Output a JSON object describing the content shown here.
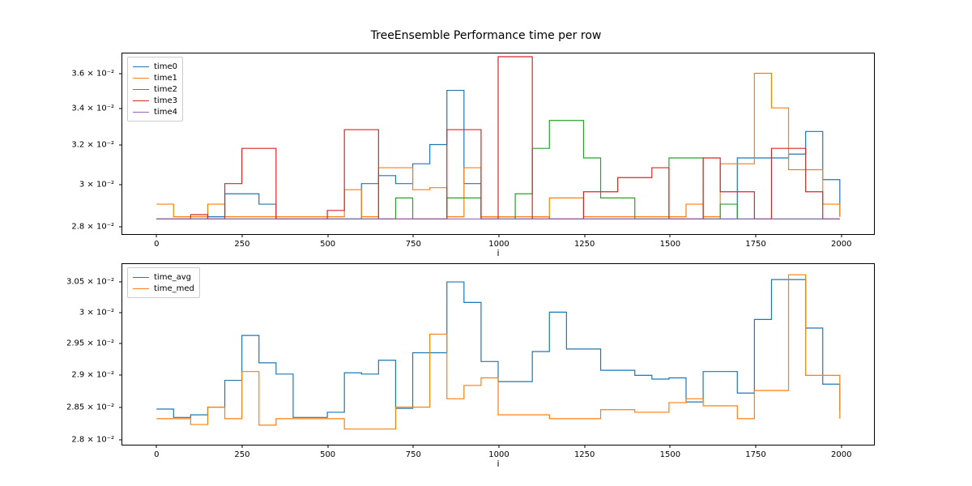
{
  "title": "TreeEnsemble Performance time per row",
  "axes_top": {
    "xlabel": "i",
    "xlim": [
      -100,
      2100
    ],
    "ylim_log": [
      0.0276,
      0.0372
    ],
    "xticks": [
      0,
      250,
      500,
      750,
      1000,
      1250,
      1500,
      1750,
      2000
    ],
    "yticks": [
      {
        "v": 0.028,
        "label": "2.8 × 10⁻²"
      },
      {
        "v": 0.03,
        "label": "3 × 10⁻²"
      },
      {
        "v": 0.032,
        "label": "3.2 × 10⁻²"
      },
      {
        "v": 0.034,
        "label": "3.4 × 10⁻²"
      },
      {
        "v": 0.036,
        "label": "3.6 × 10⁻²"
      }
    ],
    "legend": [
      {
        "label": "time0",
        "color": "#1f77b4"
      },
      {
        "label": "time1",
        "color": "#ff7f0e"
      },
      {
        "label": "time2",
        "color": "#2ca02c"
      },
      {
        "label": "time3",
        "color": "#d62728"
      },
      {
        "label": "time4",
        "color": "#9467bd"
      }
    ]
  },
  "axes_bottom": {
    "xlabel": "i",
    "xlim": [
      -100,
      2100
    ],
    "ylim_log": [
      0.0279,
      0.0308
    ],
    "xticks": [
      0,
      250,
      500,
      750,
      1000,
      1250,
      1500,
      1750,
      2000
    ],
    "yticks": [
      {
        "v": 0.028,
        "label": "2.8 × 10⁻²"
      },
      {
        "v": 0.0285,
        "label": "2.85 × 10⁻²"
      },
      {
        "v": 0.029,
        "label": "2.9 × 10⁻²"
      },
      {
        "v": 0.0295,
        "label": "2.95 × 10⁻²"
      },
      {
        "v": 0.03,
        "label": "3 × 10⁻²"
      },
      {
        "v": 0.0305,
        "label": "3.05 × 10⁻²"
      }
    ],
    "legend": [
      {
        "label": "time_avg",
        "color": "#1f77b4"
      },
      {
        "label": "time_med",
        "color": "#ff7f0e"
      }
    ]
  },
  "chart_data": [
    {
      "type": "line",
      "drawstyle": "steps-post",
      "title": "TreeEnsemble Performance time per row",
      "xlabel": "i",
      "ylabel": "",
      "yscale": "log",
      "xlim": [
        -100,
        2100
      ],
      "ylim": [
        0.0276,
        0.0372
      ],
      "x": [
        0,
        50,
        100,
        150,
        200,
        250,
        300,
        350,
        400,
        450,
        500,
        550,
        600,
        650,
        700,
        750,
        800,
        850,
        900,
        950,
        1000,
        1050,
        1100,
        1150,
        1200,
        1250,
        1300,
        1350,
        1400,
        1450,
        1500,
        1550,
        1600,
        1650,
        1700,
        1750,
        1800,
        1850,
        1900,
        1950,
        2000
      ],
      "series": [
        {
          "name": "time0",
          "color": "#1f77b4",
          "values": [
            0.0283,
            0.0283,
            0.0283,
            0.0284,
            0.0295,
            0.0295,
            0.029,
            0.0283,
            0.0283,
            0.0283,
            0.0283,
            0.0283,
            0.03,
            0.0304,
            0.03,
            0.031,
            0.032,
            0.035,
            0.03,
            0.0284,
            0.0284,
            0.0283,
            0.0284,
            0.0283,
            0.0283,
            0.0283,
            0.0283,
            0.0283,
            0.0283,
            0.0283,
            0.0283,
            0.0283,
            0.0283,
            0.0283,
            0.0313,
            0.0313,
            0.0313,
            0.0315,
            0.0327,
            0.0302,
            0.0284
          ]
        },
        {
          "name": "time1",
          "color": "#ff7f0e",
          "values": [
            0.029,
            0.0284,
            0.0284,
            0.029,
            0.0284,
            0.0284,
            0.0284,
            0.0284,
            0.0284,
            0.0284,
            0.0284,
            0.0297,
            0.0284,
            0.0308,
            0.0308,
            0.0297,
            0.0298,
            0.0284,
            0.0308,
            0.0284,
            0.0284,
            0.0284,
            0.0284,
            0.0293,
            0.0293,
            0.0284,
            0.0284,
            0.0284,
            0.0284,
            0.0284,
            0.0284,
            0.029,
            0.0284,
            0.031,
            0.031,
            0.036,
            0.034,
            0.0307,
            0.0307,
            0.029,
            0.0284
          ]
        },
        {
          "name": "time2",
          "color": "#2ca02c",
          "values": [
            0.0283,
            0.0283,
            0.0283,
            0.0283,
            0.0283,
            0.0283,
            0.0283,
            0.0283,
            0.0283,
            0.0283,
            0.0283,
            0.0283,
            0.0283,
            0.0283,
            0.0293,
            0.0283,
            0.0283,
            0.0293,
            0.0293,
            0.0283,
            0.0283,
            0.0295,
            0.0318,
            0.0333,
            0.0333,
            0.0313,
            0.0293,
            0.0293,
            0.0283,
            0.0283,
            0.0313,
            0.0313,
            0.0283,
            0.029,
            0.0283,
            0.0283,
            0.0283,
            0.0283,
            0.0283,
            0.0283,
            0.0283
          ]
        },
        {
          "name": "time3",
          "color": "#d62728",
          "values": [
            0.0283,
            0.0283,
            0.0285,
            0.0283,
            0.03,
            0.0318,
            0.0318,
            0.0283,
            0.0283,
            0.0283,
            0.0287,
            0.0328,
            0.0328,
            0.0283,
            0.0283,
            0.0283,
            0.0283,
            0.0328,
            0.0328,
            0.0283,
            0.037,
            0.037,
            0.0283,
            0.0283,
            0.0283,
            0.0296,
            0.0296,
            0.0303,
            0.0303,
            0.0308,
            0.0283,
            0.0283,
            0.0313,
            0.0296,
            0.0296,
            0.0283,
            0.0318,
            0.0318,
            0.0296,
            0.0283,
            0.0283
          ]
        },
        {
          "name": "time4",
          "color": "#9467bd",
          "values": [
            0.0283,
            0.0283,
            0.0283,
            0.0283,
            0.0283,
            0.0283,
            0.0283,
            0.0283,
            0.0283,
            0.0283,
            0.0283,
            0.0283,
            0.0283,
            0.0283,
            0.0283,
            0.0283,
            0.0283,
            0.0283,
            0.0283,
            0.0283,
            0.0283,
            0.0283,
            0.0283,
            0.0283,
            0.0283,
            0.0283,
            0.0283,
            0.0283,
            0.0283,
            0.0283,
            0.0283,
            0.0283,
            0.0283,
            0.0283,
            0.0283,
            0.0283,
            0.0283,
            0.0283,
            0.0283,
            0.0283,
            0.0283
          ]
        }
      ]
    },
    {
      "type": "line",
      "drawstyle": "steps-post",
      "xlabel": "i",
      "ylabel": "",
      "yscale": "log",
      "xlim": [
        -100,
        2100
      ],
      "ylim": [
        0.0279,
        0.0308
      ],
      "x": [
        0,
        50,
        100,
        150,
        200,
        250,
        300,
        350,
        400,
        450,
        500,
        550,
        600,
        650,
        700,
        750,
        800,
        850,
        900,
        950,
        1000,
        1050,
        1100,
        1150,
        1200,
        1250,
        1300,
        1350,
        1400,
        1450,
        1500,
        1550,
        1600,
        1650,
        1700,
        1750,
        1800,
        1850,
        1900,
        1950,
        2000
      ],
      "series": [
        {
          "name": "time_avg",
          "color": "#1f77b4",
          "values": [
            0.02845,
            0.02832,
            0.02836,
            0.02848,
            0.0289,
            0.02962,
            0.02918,
            0.029,
            0.02832,
            0.02832,
            0.0284,
            0.02902,
            0.029,
            0.02922,
            0.02846,
            0.02934,
            0.02934,
            0.0305,
            0.03016,
            0.0292,
            0.02888,
            0.02888,
            0.02936,
            0.03,
            0.0294,
            0.0294,
            0.02906,
            0.02906,
            0.02898,
            0.02892,
            0.02894,
            0.02856,
            0.02904,
            0.02904,
            0.0287,
            0.02988,
            0.03054,
            0.03054,
            0.02974,
            0.02884,
            0.02842
          ]
        },
        {
          "name": "time_med",
          "color": "#ff7f0e",
          "values": [
            0.0283,
            0.0283,
            0.02821,
            0.02848,
            0.0283,
            0.02904,
            0.0282,
            0.0283,
            0.0283,
            0.0283,
            0.0283,
            0.02814,
            0.02814,
            0.02814,
            0.02848,
            0.02848,
            0.02964,
            0.02861,
            0.02882,
            0.02894,
            0.02836,
            0.02836,
            0.02836,
            0.0283,
            0.0283,
            0.0283,
            0.02844,
            0.02844,
            0.0284,
            0.0284,
            0.02855,
            0.02861,
            0.0285,
            0.0285,
            0.0283,
            0.02874,
            0.02874,
            0.03062,
            0.02898,
            0.02898,
            0.0283
          ]
        }
      ]
    }
  ]
}
